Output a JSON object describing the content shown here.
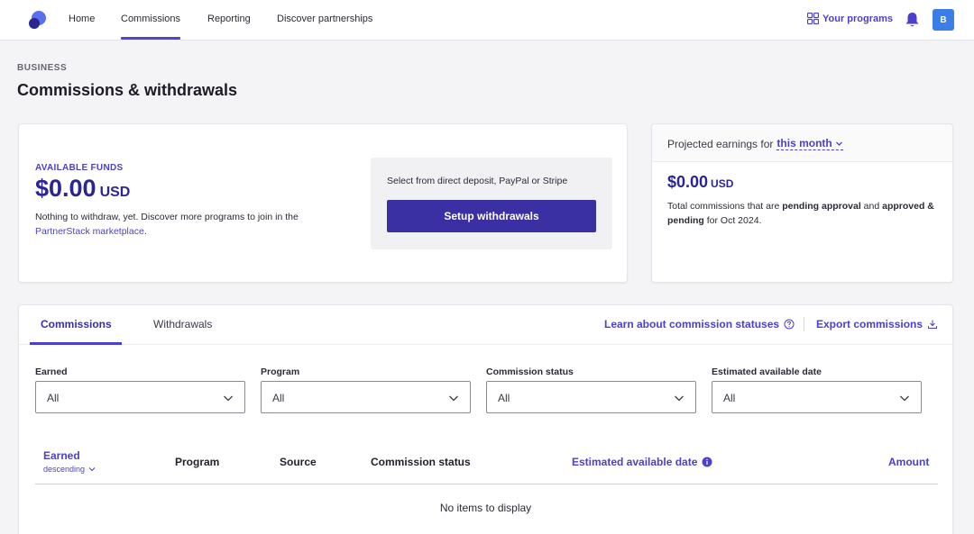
{
  "nav": {
    "items": [
      {
        "label": "Home"
      },
      {
        "label": "Commissions"
      },
      {
        "label": "Reporting"
      },
      {
        "label": "Discover partnerships"
      }
    ],
    "your_programs": "Your programs",
    "avatar_initial": "B",
    "accent_color": "#4b3fcf"
  },
  "header": {
    "eyebrow": "BUSINESS",
    "title": "Commissions & withdrawals"
  },
  "funds": {
    "label": "AVAILABLE FUNDS",
    "amount": "$0.00",
    "currency": "USD",
    "desc": "Nothing to withdraw, yet. Discover more programs to join in the",
    "link": "PartnerStack marketplace",
    "link_suffix": ".",
    "withdraw_hint": "Select from direct deposit, PayPal or Stripe",
    "setup_button": "Setup withdrawals"
  },
  "projected": {
    "heading": "Projected earnings for",
    "period": "this month",
    "amount": "$0.00",
    "currency": "USD",
    "desc_1": "Total commissions that are",
    "desc_bold_1": "pending approval",
    "desc_2": "and",
    "desc_bold_2": "approved & pending",
    "desc_3": "for Oct 2024."
  },
  "table": {
    "tabs": [
      {
        "label": "Commissions"
      },
      {
        "label": "Withdrawals"
      }
    ],
    "learn_link": "Learn about commission statuses",
    "export_link": "Export commissions",
    "filters": [
      {
        "label": "Earned",
        "value": "All"
      },
      {
        "label": "Program",
        "value": "All"
      },
      {
        "label": "Commission status",
        "value": "All"
      },
      {
        "label": "Estimated available date",
        "value": "All"
      }
    ],
    "columns": {
      "earned": "Earned",
      "earned_sort": "descending",
      "program": "Program",
      "source": "Source",
      "status": "Commission status",
      "available_date": "Estimated available date",
      "amount": "Amount"
    },
    "empty_text": "No items to display"
  }
}
